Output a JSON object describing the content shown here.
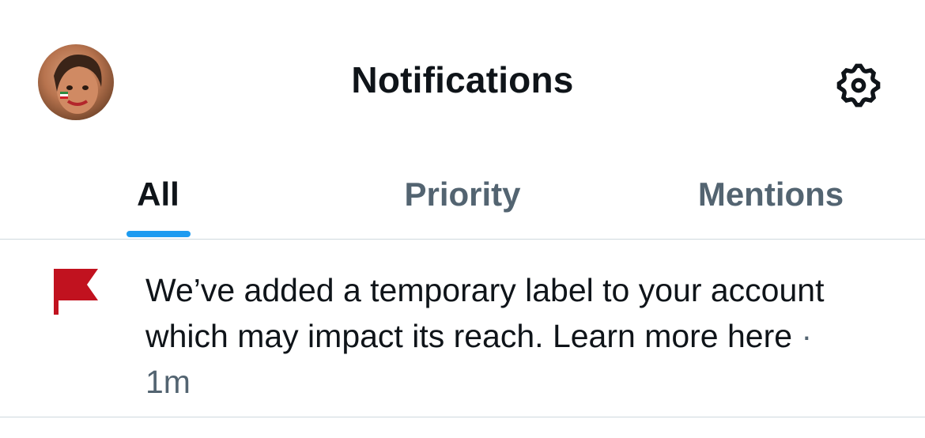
{
  "header": {
    "title": "Notifications",
    "avatar_icon": "profile-avatar",
    "settings_icon": "gear-icon"
  },
  "tabs": [
    {
      "label": "All",
      "active": true
    },
    {
      "label": "Priority",
      "active": false
    },
    {
      "label": "Mentions",
      "active": false
    }
  ],
  "notifications": [
    {
      "icon": "flag-icon",
      "icon_color": "#c1121f",
      "text": "We’ve added a temporary label to your account which may impact its reach. Learn more here",
      "separator": "·",
      "time": "1m"
    }
  ],
  "colors": {
    "accent": "#1d9bf0",
    "text_primary": "#0f1419",
    "text_secondary": "#536471",
    "divider": "#cfd9de"
  }
}
